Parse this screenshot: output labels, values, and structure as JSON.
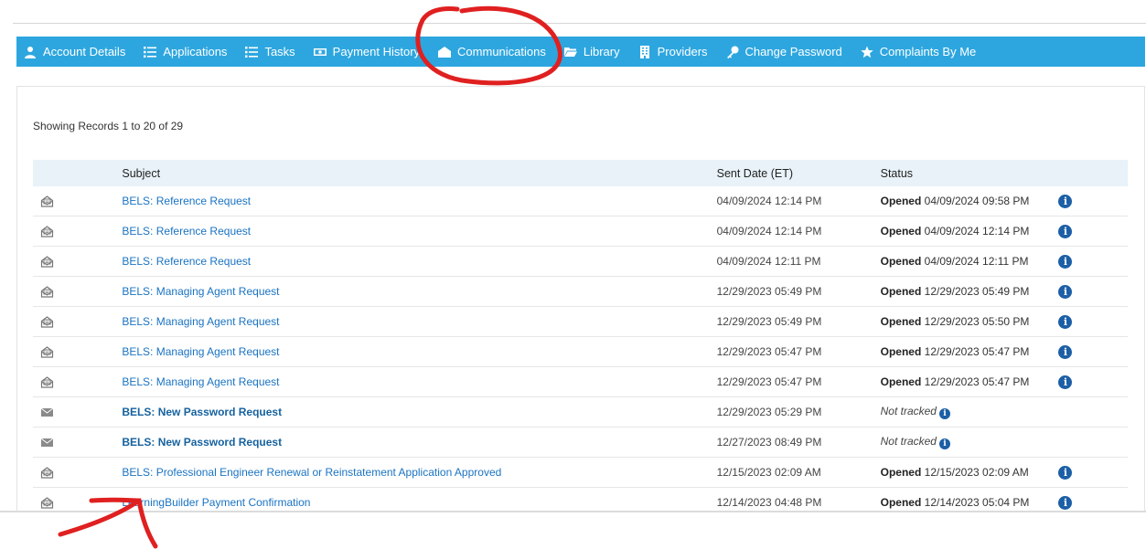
{
  "nav": {
    "items": [
      {
        "label": "Account Details",
        "icon": "user-icon"
      },
      {
        "label": "Applications",
        "icon": "list-icon"
      },
      {
        "label": "Tasks",
        "icon": "list-icon"
      },
      {
        "label": "Payment History",
        "icon": "money-icon"
      },
      {
        "label": "Communications",
        "icon": "envelope-open-icon"
      },
      {
        "label": "Library",
        "icon": "folder-icon"
      },
      {
        "label": "Providers",
        "icon": "building-icon"
      },
      {
        "label": "Change Password",
        "icon": "key-icon"
      },
      {
        "label": "Complaints By Me",
        "icon": "star-icon"
      }
    ],
    "bg_color": "#2da6df"
  },
  "records_text": "Showing Records 1 to 20 of 29",
  "table": {
    "headers": {
      "subject": "Subject",
      "sent_date": "Sent Date (ET)",
      "status": "Status"
    },
    "rows": [
      {
        "icon": "opened-envelope-icon",
        "subject": "BELS: Reference Request",
        "bold": false,
        "sent_date": "04/09/2024 12:14 PM",
        "status_label": "Opened",
        "status_date": "04/09/2024 09:58 PM",
        "tracked": true
      },
      {
        "icon": "opened-envelope-icon",
        "subject": "BELS: Reference Request",
        "bold": false,
        "sent_date": "04/09/2024 12:14 PM",
        "status_label": "Opened",
        "status_date": "04/09/2024 12:14 PM",
        "tracked": true
      },
      {
        "icon": "opened-envelope-icon",
        "subject": "BELS: Reference Request",
        "bold": false,
        "sent_date": "04/09/2024 12:11 PM",
        "status_label": "Opened",
        "status_date": "04/09/2024 12:11 PM",
        "tracked": true
      },
      {
        "icon": "opened-envelope-icon",
        "subject": "BELS: Managing Agent Request",
        "bold": false,
        "sent_date": "12/29/2023 05:49 PM",
        "status_label": "Opened",
        "status_date": "12/29/2023 05:49 PM",
        "tracked": true
      },
      {
        "icon": "opened-envelope-icon",
        "subject": "BELS: Managing Agent Request",
        "bold": false,
        "sent_date": "12/29/2023 05:49 PM",
        "status_label": "Opened",
        "status_date": "12/29/2023 05:50 PM",
        "tracked": true
      },
      {
        "icon": "opened-envelope-icon",
        "subject": "BELS: Managing Agent Request",
        "bold": false,
        "sent_date": "12/29/2023 05:47 PM",
        "status_label": "Opened",
        "status_date": "12/29/2023 05:47 PM",
        "tracked": true
      },
      {
        "icon": "opened-envelope-icon",
        "subject": "BELS: Managing Agent Request",
        "bold": false,
        "sent_date": "12/29/2023 05:47 PM",
        "status_label": "Opened",
        "status_date": "12/29/2023 05:47 PM",
        "tracked": true
      },
      {
        "icon": "closed-envelope-icon",
        "subject": "BELS: New Password Request",
        "bold": true,
        "sent_date": "12/29/2023 05:29 PM",
        "status_label": "Not tracked",
        "status_date": "",
        "tracked": false
      },
      {
        "icon": "closed-envelope-icon",
        "subject": "BELS: New Password Request",
        "bold": true,
        "sent_date": "12/27/2023 08:49 PM",
        "status_label": "Not tracked",
        "status_date": "",
        "tracked": false
      },
      {
        "icon": "opened-envelope-icon",
        "subject": "BELS: Professional Engineer Renewal or Reinstatement Application Approved",
        "bold": false,
        "sent_date": "12/15/2023 02:09 AM",
        "status_label": "Opened",
        "status_date": "12/15/2023 02:09 AM",
        "tracked": true
      },
      {
        "icon": "opened-envelope-icon",
        "subject": "LearningBuilder Payment Confirmation",
        "bold": false,
        "sent_date": "12/14/2023 04:48 PM",
        "status_label": "Opened",
        "status_date": "12/14/2023 05:04 PM",
        "tracked": true
      }
    ]
  },
  "colors": {
    "link": "#1a73c2",
    "info": "#1c5fa6",
    "annotation": "#e02020"
  }
}
